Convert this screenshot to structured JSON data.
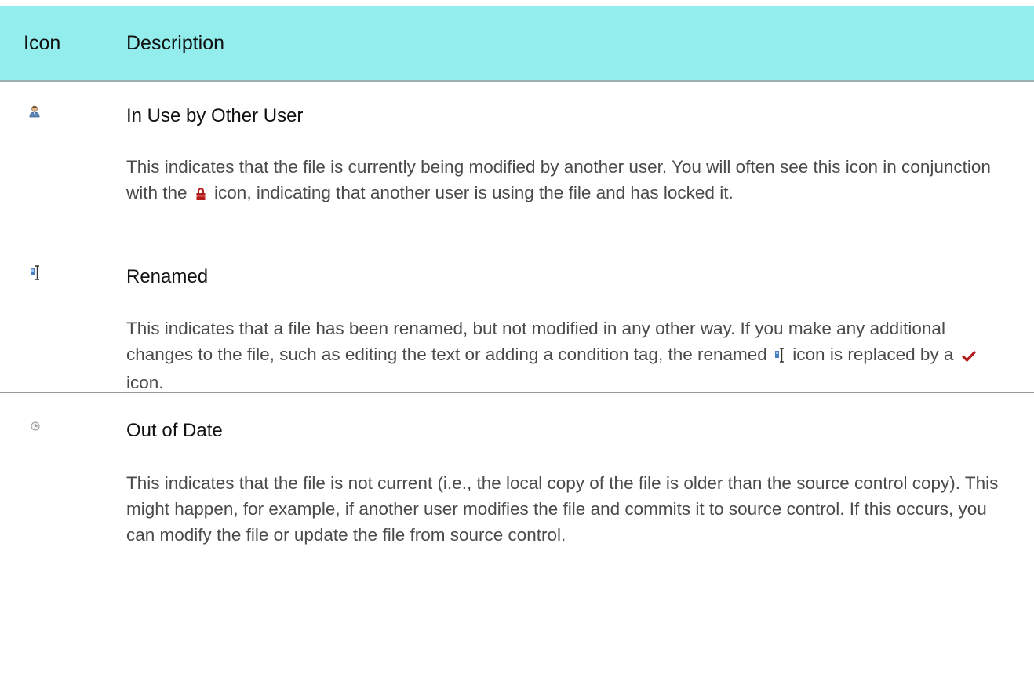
{
  "header": {
    "icon_label": "Icon",
    "description_label": "Description"
  },
  "colors": {
    "header_bg": "#93eded",
    "lock_icon": "#b31b1b",
    "checkmark_icon": "#b31b1b"
  },
  "rows": [
    {
      "icon": "user-icon",
      "title": "In Use by Other User",
      "body_parts": [
        "This indicates that the file is currently being modified by another user. You will often see this icon in conjunction with the",
        "icon, indicating that another user is using the file and has locked it."
      ],
      "inline_icons": [
        "lock-icon"
      ]
    },
    {
      "icon": "rename-icon",
      "title": "Renamed",
      "body_parts": [
        "This indicates that a file has been renamed, but not modified in any other way. If you make any additional changes to the file, such as editing the text or adding a condition tag, the renamed",
        "icon is replaced by a",
        "icon."
      ],
      "inline_icons": [
        "rename-icon",
        "checkmark-icon"
      ]
    },
    {
      "icon": "clock-icon",
      "title": "Out of Date",
      "body": "This indicates that the file is not current (i.e., the local copy of the file is older than the source control copy). This might happen, for example, if another user modifies the file and commits it to source control. If this occurs, you can modify the file or update the file from source control."
    }
  ]
}
